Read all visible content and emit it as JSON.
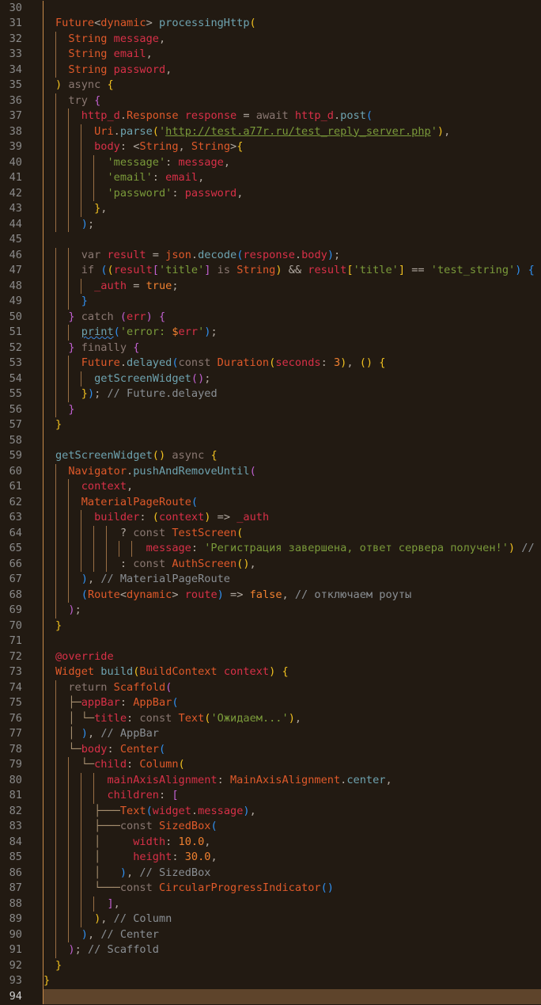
{
  "editor": {
    "language": "dart",
    "current_line": 94,
    "colors": {
      "background": "#221a12",
      "current_line_highlight": "#5e442b",
      "line_number": "#8a8a8a",
      "indent_guide": "#9a6f45"
    },
    "lines": [
      {
        "n": "30",
        "text": ""
      },
      {
        "n": "31",
        "text": "Future<dynamic> processingHttp("
      },
      {
        "n": "32",
        "text": "  String message,"
      },
      {
        "n": "33",
        "text": "  String email,"
      },
      {
        "n": "34",
        "text": "  String password,"
      },
      {
        "n": "35",
        "text": ") async {"
      },
      {
        "n": "36",
        "text": "  try {"
      },
      {
        "n": "37",
        "text": "    http_d.Response response = await http_d.post("
      },
      {
        "n": "38",
        "text": "      Uri.parse('http://test.a77r.ru/test_reply_server.php'),"
      },
      {
        "n": "39",
        "text": "      body: <String, String>{"
      },
      {
        "n": "40",
        "text": "        'message': message,"
      },
      {
        "n": "41",
        "text": "        'email': email,"
      },
      {
        "n": "42",
        "text": "        'password': password,"
      },
      {
        "n": "43",
        "text": "      },"
      },
      {
        "n": "44",
        "text": "    );"
      },
      {
        "n": "45",
        "text": ""
      },
      {
        "n": "46",
        "text": "    var result = json.decode(response.body);"
      },
      {
        "n": "47",
        "text": "    if ((result['title'] is String) && result['title'] == 'test_string') {"
      },
      {
        "n": "48",
        "text": "      _auth = true;"
      },
      {
        "n": "49",
        "text": "    }"
      },
      {
        "n": "50",
        "text": "  } catch (err) {"
      },
      {
        "n": "51",
        "text": "    print('error: $err');"
      },
      {
        "n": "52",
        "text": "  } finally {"
      },
      {
        "n": "53",
        "text": "    Future.delayed(const Duration(seconds: 3), () {"
      },
      {
        "n": "54",
        "text": "      getScreenWidget();"
      },
      {
        "n": "55",
        "text": "    }); // Future.delayed"
      },
      {
        "n": "56",
        "text": "  }"
      },
      {
        "n": "57",
        "text": "}"
      },
      {
        "n": "58",
        "text": ""
      },
      {
        "n": "59",
        "text": "getScreenWidget() async {"
      },
      {
        "n": "60",
        "text": "  Navigator.pushAndRemoveUntil("
      },
      {
        "n": "61",
        "text": "    context,"
      },
      {
        "n": "62",
        "text": "    MaterialPageRoute("
      },
      {
        "n": "63",
        "text": "      builder: (context) => _auth"
      },
      {
        "n": "64",
        "text": "          ? const TestScreen("
      },
      {
        "n": "65",
        "text": "              message: 'Регистрация завершена, ответ сервера получен!') // TestScreen"
      },
      {
        "n": "66",
        "text": "          : const AuthScreen(),"
      },
      {
        "n": "67",
        "text": "    ), // MaterialPageRoute"
      },
      {
        "n": "68",
        "text": "    (Route<dynamic> route) => false, // отключаем роуты"
      },
      {
        "n": "69",
        "text": "  );"
      },
      {
        "n": "70",
        "text": "}"
      },
      {
        "n": "71",
        "text": ""
      },
      {
        "n": "72",
        "text": "@override"
      },
      {
        "n": "73",
        "text": "Widget build(BuildContext context) {"
      },
      {
        "n": "74",
        "text": "  return Scaffold("
      },
      {
        "n": "75",
        "text": "  ├─appBar: AppBar("
      },
      {
        "n": "76",
        "text": "  │ └─title: const Text('Ожидаем...'),"
      },
      {
        "n": "77",
        "text": "  │ ), // AppBar"
      },
      {
        "n": "78",
        "text": "  └─body: Center("
      },
      {
        "n": "79",
        "text": "    └─child: Column("
      },
      {
        "n": "80",
        "text": "        mainAxisAlignment: MainAxisAlignment.center,"
      },
      {
        "n": "81",
        "text": "        children: ["
      },
      {
        "n": "82",
        "text": "      ├───Text(widget.message),"
      },
      {
        "n": "83",
        "text": "      ├───const SizedBox("
      },
      {
        "n": "84",
        "text": "      │     width: 10.0,"
      },
      {
        "n": "85",
        "text": "      │     height: 30.0,"
      },
      {
        "n": "86",
        "text": "      │   ), // SizedBox"
      },
      {
        "n": "87",
        "text": "      └───const CircularProgressIndicator()"
      },
      {
        "n": "88",
        "text": "        ],"
      },
      {
        "n": "89",
        "text": "      ), // Column"
      },
      {
        "n": "90",
        "text": "    ), // Center"
      },
      {
        "n": "91",
        "text": "  ); // Scaffold"
      },
      {
        "n": "92",
        "text": "}"
      },
      {
        "n": "93",
        "text": "}"
      },
      {
        "n": "94",
        "text": ""
      }
    ]
  }
}
